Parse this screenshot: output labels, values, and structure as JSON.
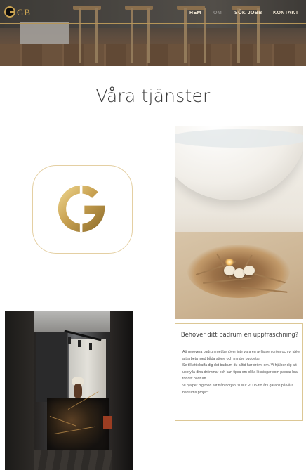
{
  "header": {
    "logo_text": "GB",
    "nav": [
      {
        "label": "HEM"
      },
      {
        "label": "OM"
      },
      {
        "label": "SÖK JOBB"
      },
      {
        "label": "KONTAKT"
      }
    ]
  },
  "main": {
    "title": "Våra tjänster",
    "service_card": {
      "heading": "Behöver ditt badrum en uppfräschning?",
      "paragraphs": [
        "Att renovera badrummet behöver inte vara en avlägsen dröm och vi idéer att arbeta med båda större och mindre budgetar.",
        "Se till att skaffa dig det badrum du alltid har drömt om. Vi hjälper dig att uppfylla dina drömmar och kan tipsa om olika lösningar som passar bra för ditt badrum.",
        "Vi hjälper dig med allt från början till slut PLUS tio års garanti på våra badrums project."
      ]
    }
  },
  "colors": {
    "gold": "#c9a252",
    "gold_light": "#e4cfa2",
    "title_text": "#3b3b3b",
    "nav_text": "#f3e9d6"
  },
  "icons": {
    "brand_logo": "g-monogram-icon"
  }
}
